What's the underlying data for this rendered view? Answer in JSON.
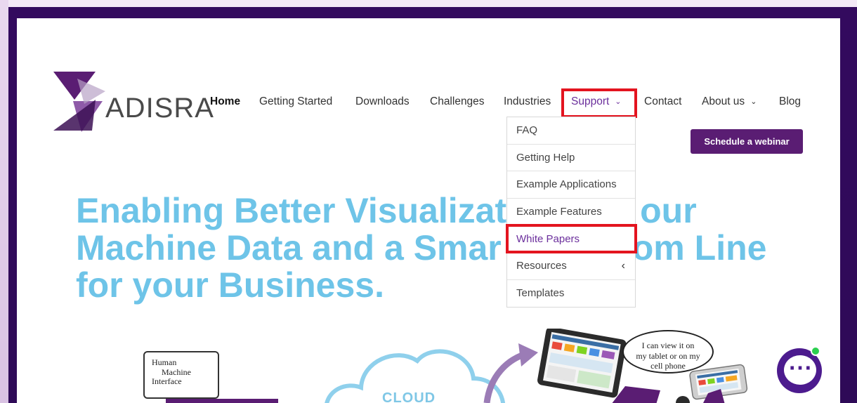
{
  "logo": {
    "text": "ADISRA"
  },
  "nav": {
    "items": [
      {
        "label": "Home"
      },
      {
        "label": "Getting Started"
      },
      {
        "label": "Downloads"
      },
      {
        "label": "Challenges"
      },
      {
        "label": "Industries"
      },
      {
        "label": "Support"
      },
      {
        "label": "Contact"
      },
      {
        "label": "About us"
      },
      {
        "label": "Blog"
      }
    ],
    "chevron": "⌄"
  },
  "cta": {
    "schedule_label": "Schedule a webinar"
  },
  "dropdown": {
    "items": [
      {
        "label": "FAQ"
      },
      {
        "label": "Getting Help"
      },
      {
        "label": "Example Applications"
      },
      {
        "label": "Example Features"
      },
      {
        "label": "White Papers"
      },
      {
        "label": "Resources",
        "submenu_glyph": "‹"
      },
      {
        "label": "Templates"
      }
    ]
  },
  "hero": {
    "line1": "Enabling Better Visualizat",
    "line1b": "our",
    "line2": "Machine Data and a Smar",
    "line2b": "om Line",
    "line3": "for your Business."
  },
  "illustration": {
    "hmi_lines": [
      "Human",
      "Machine",
      "Interface"
    ],
    "cloud": "CLOUD",
    "speech_lines": [
      "I can view it on",
      "my tablet or on my",
      "cell phone"
    ]
  },
  "chat": {
    "glyph": "⋯"
  },
  "colors": {
    "brand_purple": "#5a1d73",
    "headline_blue": "#6ec4e8",
    "highlight_red": "#e3141f",
    "active_link": "#6b2f9c"
  }
}
